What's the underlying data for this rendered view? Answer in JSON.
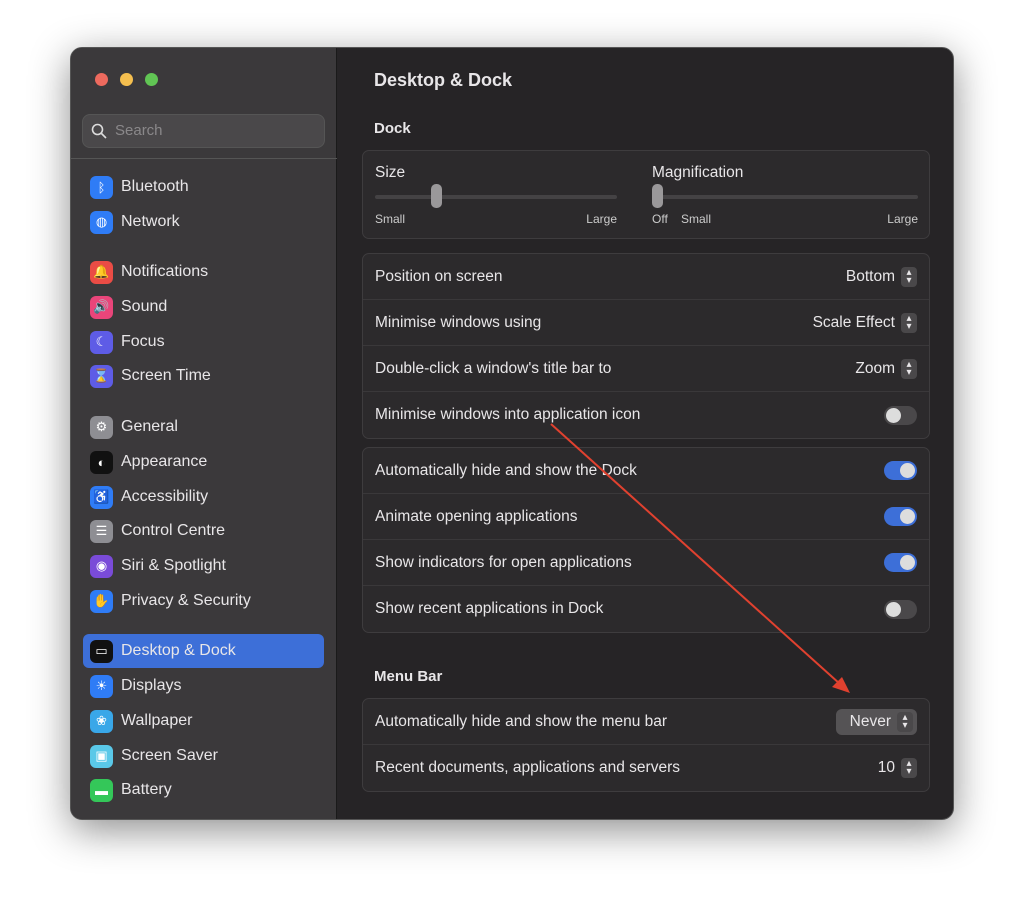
{
  "window": {
    "traffic_lights": [
      "#ed6a5e",
      "#f5bf4f",
      "#61c554"
    ]
  },
  "search": {
    "placeholder": "Search"
  },
  "sidebar": {
    "items": [
      {
        "label": "Bluetooth",
        "icon": "bluetooth-icon",
        "color": "#2f7cf6",
        "glyph": "ᛒ"
      },
      {
        "label": "Network",
        "icon": "globe-icon",
        "color": "#2f7cf6",
        "glyph": "◍"
      },
      {
        "label": "Notifications",
        "icon": "bell-icon",
        "color": "#ea4c45",
        "glyph": "🔔"
      },
      {
        "label": "Sound",
        "icon": "speaker-icon",
        "color": "#e9457a",
        "glyph": "🔊"
      },
      {
        "label": "Focus",
        "icon": "moon-icon",
        "color": "#5e5ce6",
        "glyph": "☾"
      },
      {
        "label": "Screen Time",
        "icon": "hourglass-icon",
        "color": "#5e5ce6",
        "glyph": "⌛"
      },
      {
        "label": "General",
        "icon": "gear-icon",
        "color": "#8e8e93",
        "glyph": "⚙"
      },
      {
        "label": "Appearance",
        "icon": "appearance-icon",
        "color": "#111111",
        "glyph": "◐"
      },
      {
        "label": "Accessibility",
        "icon": "accessibility-icon",
        "color": "#2f7cf6",
        "glyph": "♿"
      },
      {
        "label": "Control Centre",
        "icon": "toggles-icon",
        "color": "#8e8e93",
        "glyph": "☰"
      },
      {
        "label": "Siri & Spotlight",
        "icon": "siri-icon",
        "color": "#7a4bd8",
        "glyph": "◉"
      },
      {
        "label": "Privacy & Security",
        "icon": "hand-icon",
        "color": "#2f7cf6",
        "glyph": "✋"
      },
      {
        "label": "Desktop & Dock",
        "icon": "dock-icon",
        "color": "#111111",
        "glyph": "▭",
        "selected": true
      },
      {
        "label": "Displays",
        "icon": "sun-icon",
        "color": "#2f7cf6",
        "glyph": "☀"
      },
      {
        "label": "Wallpaper",
        "icon": "flower-icon",
        "color": "#39a7e8",
        "glyph": "❀"
      },
      {
        "label": "Screen Saver",
        "icon": "screensaver-icon",
        "color": "#5ac8e8",
        "glyph": "▣"
      },
      {
        "label": "Battery",
        "icon": "battery-icon",
        "color": "#34c759",
        "glyph": "▬"
      }
    ]
  },
  "main": {
    "title": "Desktop & Dock",
    "dock_heading": "Dock",
    "size": {
      "label": "Size",
      "min": "Small",
      "max": "Large",
      "value": 0.25
    },
    "magnification": {
      "label": "Magnification",
      "off": "Off",
      "min": "Small",
      "max": "Large",
      "value": 0
    },
    "group1": [
      {
        "label": "Position on screen",
        "value": "Bottom"
      },
      {
        "label": "Minimise windows using",
        "value": "Scale Effect"
      },
      {
        "label": "Double-click a window's title bar to",
        "value": "Zoom"
      },
      {
        "label": "Minimise windows into application icon",
        "toggle": false
      }
    ],
    "group2": [
      {
        "label": "Automatically hide and show the Dock",
        "toggle": true
      },
      {
        "label": "Animate opening applications",
        "toggle": true
      },
      {
        "label": "Show indicators for open applications",
        "toggle": true
      },
      {
        "label": "Show recent applications in Dock",
        "toggle": false
      }
    ],
    "menubar_heading": "Menu Bar",
    "group3": [
      {
        "label": "Automatically hide and show the menu bar",
        "value": "Never"
      },
      {
        "label": "Recent documents, applications and servers",
        "value": "10"
      }
    ]
  },
  "annotation": {
    "arrow_color": "#e0412f"
  }
}
